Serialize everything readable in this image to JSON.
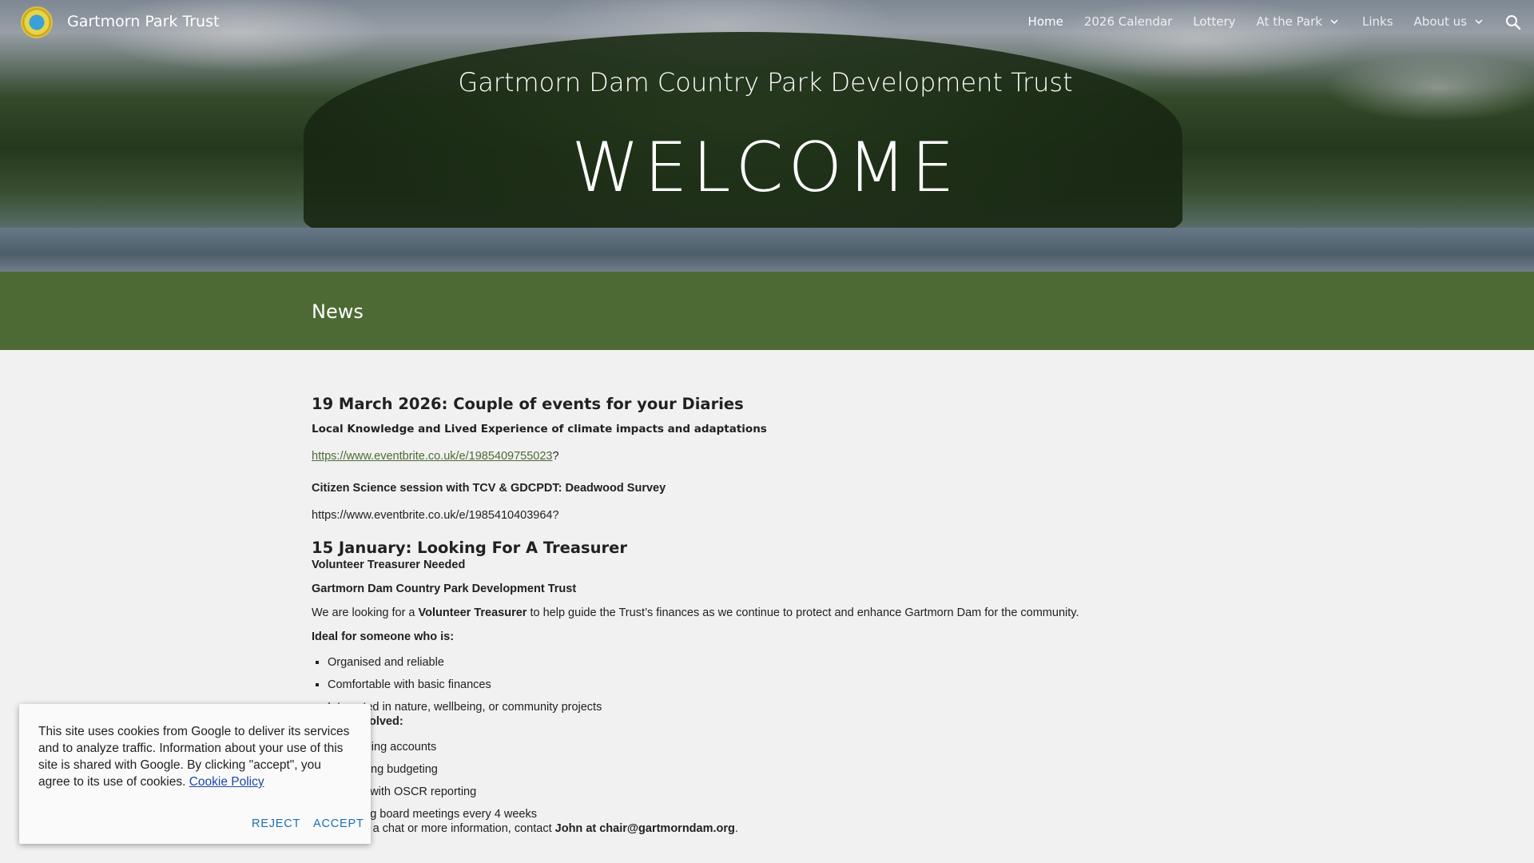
{
  "site": {
    "title": "Gartmorn Park Trust",
    "hero_subtitle": "Gartmorn Dam Country Park Development Trust",
    "hero_title": "WELCOME"
  },
  "nav": {
    "items": [
      {
        "label": "Home",
        "active": true
      },
      {
        "label": "2026 Calendar"
      },
      {
        "label": "Lottery"
      },
      {
        "label": "At the Park",
        "has_dropdown": true
      },
      {
        "label": "Links"
      },
      {
        "label": "About us",
        "has_dropdown": true
      }
    ],
    "search_icon": "search-icon"
  },
  "band": {
    "title": "News"
  },
  "news": {
    "post1": {
      "heading": "19 March 2026: Couple of events for your Diaries",
      "event1_title": "Local Knowledge and Lived Experience of climate impacts and adaptations",
      "event1_link": "https://www.eventbrite.co.uk/e/1985409755023",
      "event1_suffix": "?",
      "event2_title": "Citizen Science session with TCV & GDCPDT: Deadwood Survey",
      "event2_link": "https://www.eventbrite.co.uk/e/1985410403964?"
    },
    "post2": {
      "heading": "15 January: Looking For A Treasurer",
      "sub1": "Volunteer Treasurer Needed",
      "sub2": "Gartmorn Dam Country Park Development Trust",
      "intro_pre": "We are looking for a ",
      "intro_bold": "Volunteer Treasurer",
      "intro_post": " to help guide the Trust’s finances as we continue to protect and enhance Gartmorn Dam for the community.",
      "ideal_heading": "Ideal for someone who is:",
      "ideal_items": [
        "Organised and reliable",
        "Comfortable with basic finances",
        "Interested in nature, wellbeing, or community projects"
      ],
      "involved_heading": "What’s involved:",
      "involved_items": [
        "Overseeing accounts",
        "Supporting budgeting",
        "Helping with OSCR reporting",
        "Attending board meetings every 4 weeks"
      ],
      "contact_pre": "If you’d like a chat or more information, contact ",
      "contact_bold": "John at chair@gartmorndam.org",
      "contact_post": "."
    }
  },
  "cookie": {
    "text": "This site uses cookies from Google to deliver its services and to analyze traffic. Information about your use of this site is shared with Google. By clicking \"accept\", you agree to its use of cookies. ",
    "link": "Cookie Policy",
    "reject": "REJECT",
    "accept": "ACCEPT"
  }
}
